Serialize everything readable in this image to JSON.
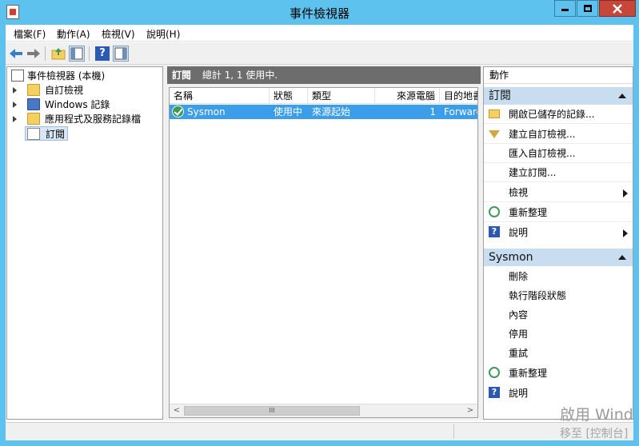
{
  "window": {
    "title": "事件檢視器"
  },
  "menubar": {
    "items": [
      "檔案(F)",
      "動作(A)",
      "檢視(V)",
      "說明(H)"
    ]
  },
  "tree": {
    "root_label": "事件檢視器 (本機)",
    "items": [
      {
        "label": "自訂檢視"
      },
      {
        "label": "Windows 記錄"
      },
      {
        "label": "應用程式及服務記錄檔"
      },
      {
        "label": "訂閱"
      }
    ]
  },
  "center": {
    "header_title": "訂閱",
    "header_summary": "總計 1, 1 使用中.",
    "columns": [
      "名稱",
      "狀態",
      "類型",
      "來源電腦",
      "目的地書"
    ],
    "rows": [
      {
        "name": "Sysmon",
        "status": "使用中",
        "type": "來源起始",
        "source_count": "1",
        "destination": "Forwarded"
      }
    ],
    "scroll_thumb_label": "III",
    "scroll_left": "<",
    "scroll_right": ">"
  },
  "actions": {
    "title": "動作",
    "sections": [
      {
        "title": "訂閱",
        "items": [
          {
            "label": "開啟已儲存的記錄..."
          },
          {
            "label": "建立自訂檢視..."
          },
          {
            "label": "匯入自訂檢視..."
          },
          {
            "label": "建立訂閱..."
          },
          {
            "label": "檢視"
          },
          {
            "label": "重新整理"
          },
          {
            "label": "說明"
          }
        ]
      },
      {
        "title": "Sysmon",
        "items": [
          {
            "label": "刪除"
          },
          {
            "label": "執行階段狀態"
          },
          {
            "label": "內容"
          },
          {
            "label": "停用"
          },
          {
            "label": "重試"
          },
          {
            "label": "重新整理"
          },
          {
            "label": "說明"
          }
        ]
      }
    ]
  },
  "watermark": {
    "line1": "啟用 Wind",
    "line2": "移至 [控制台]"
  },
  "colors": {
    "titlebar": "#5ec2ee",
    "selection": "#3c9de8",
    "section_header": "#c8ddef",
    "center_header": "#6d6d6d"
  },
  "icons": {
    "app": "event-viewer-icon",
    "back": "back-arrow-icon",
    "forward": "forward-arrow-icon",
    "up": "up-folder-icon",
    "show_hide": "show-hide-tree-icon",
    "help": "help-icon",
    "properties": "properties-icon"
  }
}
